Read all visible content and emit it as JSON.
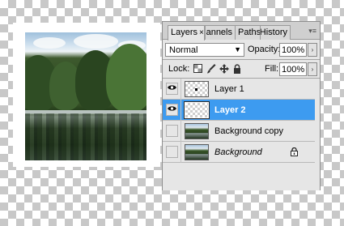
{
  "panel": {
    "tabs": [
      {
        "label": "Layers",
        "close": "×"
      },
      {
        "label": "Channels"
      },
      {
        "label": "Paths"
      },
      {
        "label": "History"
      }
    ],
    "menu_glyph": "▾≡",
    "blend_mode": "Normal",
    "opacity_label": "Opacity:",
    "opacity_value": "100%",
    "lock_label": "Lock:",
    "fill_label": "Fill:",
    "fill_value": "100%",
    "spin_glyph": "›",
    "select_arrow": "▼"
  },
  "layers": [
    {
      "name": "Layer 1",
      "visible_glyph": "👁",
      "selected": false
    },
    {
      "name": "Layer 2",
      "visible_glyph": "👁",
      "selected": true
    },
    {
      "name": "Background copy",
      "visible_glyph": "",
      "selected": false
    },
    {
      "name": "Background",
      "visible_glyph": "",
      "selected": false,
      "lock_glyph": "🔒"
    }
  ],
  "colors": {
    "selection": "#3d9bf0",
    "panel_bg": "#e6e6e6"
  }
}
